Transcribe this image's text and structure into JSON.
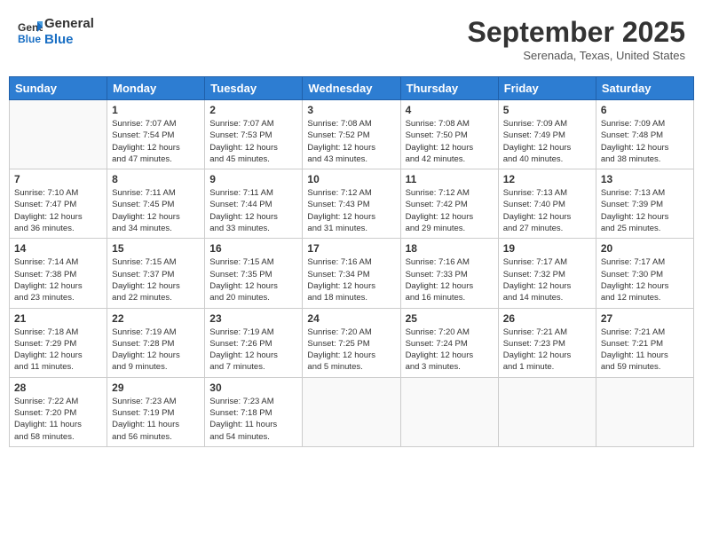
{
  "header": {
    "logo_line1": "General",
    "logo_line2": "Blue",
    "month_title": "September 2025",
    "location": "Serenada, Texas, United States"
  },
  "weekdays": [
    "Sunday",
    "Monday",
    "Tuesday",
    "Wednesday",
    "Thursday",
    "Friday",
    "Saturday"
  ],
  "weeks": [
    [
      {
        "day": "",
        "info": ""
      },
      {
        "day": "1",
        "info": "Sunrise: 7:07 AM\nSunset: 7:54 PM\nDaylight: 12 hours\nand 47 minutes."
      },
      {
        "day": "2",
        "info": "Sunrise: 7:07 AM\nSunset: 7:53 PM\nDaylight: 12 hours\nand 45 minutes."
      },
      {
        "day": "3",
        "info": "Sunrise: 7:08 AM\nSunset: 7:52 PM\nDaylight: 12 hours\nand 43 minutes."
      },
      {
        "day": "4",
        "info": "Sunrise: 7:08 AM\nSunset: 7:50 PM\nDaylight: 12 hours\nand 42 minutes."
      },
      {
        "day": "5",
        "info": "Sunrise: 7:09 AM\nSunset: 7:49 PM\nDaylight: 12 hours\nand 40 minutes."
      },
      {
        "day": "6",
        "info": "Sunrise: 7:09 AM\nSunset: 7:48 PM\nDaylight: 12 hours\nand 38 minutes."
      }
    ],
    [
      {
        "day": "7",
        "info": "Sunrise: 7:10 AM\nSunset: 7:47 PM\nDaylight: 12 hours\nand 36 minutes."
      },
      {
        "day": "8",
        "info": "Sunrise: 7:11 AM\nSunset: 7:45 PM\nDaylight: 12 hours\nand 34 minutes."
      },
      {
        "day": "9",
        "info": "Sunrise: 7:11 AM\nSunset: 7:44 PM\nDaylight: 12 hours\nand 33 minutes."
      },
      {
        "day": "10",
        "info": "Sunrise: 7:12 AM\nSunset: 7:43 PM\nDaylight: 12 hours\nand 31 minutes."
      },
      {
        "day": "11",
        "info": "Sunrise: 7:12 AM\nSunset: 7:42 PM\nDaylight: 12 hours\nand 29 minutes."
      },
      {
        "day": "12",
        "info": "Sunrise: 7:13 AM\nSunset: 7:40 PM\nDaylight: 12 hours\nand 27 minutes."
      },
      {
        "day": "13",
        "info": "Sunrise: 7:13 AM\nSunset: 7:39 PM\nDaylight: 12 hours\nand 25 minutes."
      }
    ],
    [
      {
        "day": "14",
        "info": "Sunrise: 7:14 AM\nSunset: 7:38 PM\nDaylight: 12 hours\nand 23 minutes."
      },
      {
        "day": "15",
        "info": "Sunrise: 7:15 AM\nSunset: 7:37 PM\nDaylight: 12 hours\nand 22 minutes."
      },
      {
        "day": "16",
        "info": "Sunrise: 7:15 AM\nSunset: 7:35 PM\nDaylight: 12 hours\nand 20 minutes."
      },
      {
        "day": "17",
        "info": "Sunrise: 7:16 AM\nSunset: 7:34 PM\nDaylight: 12 hours\nand 18 minutes."
      },
      {
        "day": "18",
        "info": "Sunrise: 7:16 AM\nSunset: 7:33 PM\nDaylight: 12 hours\nand 16 minutes."
      },
      {
        "day": "19",
        "info": "Sunrise: 7:17 AM\nSunset: 7:32 PM\nDaylight: 12 hours\nand 14 minutes."
      },
      {
        "day": "20",
        "info": "Sunrise: 7:17 AM\nSunset: 7:30 PM\nDaylight: 12 hours\nand 12 minutes."
      }
    ],
    [
      {
        "day": "21",
        "info": "Sunrise: 7:18 AM\nSunset: 7:29 PM\nDaylight: 12 hours\nand 11 minutes."
      },
      {
        "day": "22",
        "info": "Sunrise: 7:19 AM\nSunset: 7:28 PM\nDaylight: 12 hours\nand 9 minutes."
      },
      {
        "day": "23",
        "info": "Sunrise: 7:19 AM\nSunset: 7:26 PM\nDaylight: 12 hours\nand 7 minutes."
      },
      {
        "day": "24",
        "info": "Sunrise: 7:20 AM\nSunset: 7:25 PM\nDaylight: 12 hours\nand 5 minutes."
      },
      {
        "day": "25",
        "info": "Sunrise: 7:20 AM\nSunset: 7:24 PM\nDaylight: 12 hours\nand 3 minutes."
      },
      {
        "day": "26",
        "info": "Sunrise: 7:21 AM\nSunset: 7:23 PM\nDaylight: 12 hours\nand 1 minute."
      },
      {
        "day": "27",
        "info": "Sunrise: 7:21 AM\nSunset: 7:21 PM\nDaylight: 11 hours\nand 59 minutes."
      }
    ],
    [
      {
        "day": "28",
        "info": "Sunrise: 7:22 AM\nSunset: 7:20 PM\nDaylight: 11 hours\nand 58 minutes."
      },
      {
        "day": "29",
        "info": "Sunrise: 7:23 AM\nSunset: 7:19 PM\nDaylight: 11 hours\nand 56 minutes."
      },
      {
        "day": "30",
        "info": "Sunrise: 7:23 AM\nSunset: 7:18 PM\nDaylight: 11 hours\nand 54 minutes."
      },
      {
        "day": "",
        "info": ""
      },
      {
        "day": "",
        "info": ""
      },
      {
        "day": "",
        "info": ""
      },
      {
        "day": "",
        "info": ""
      }
    ]
  ]
}
